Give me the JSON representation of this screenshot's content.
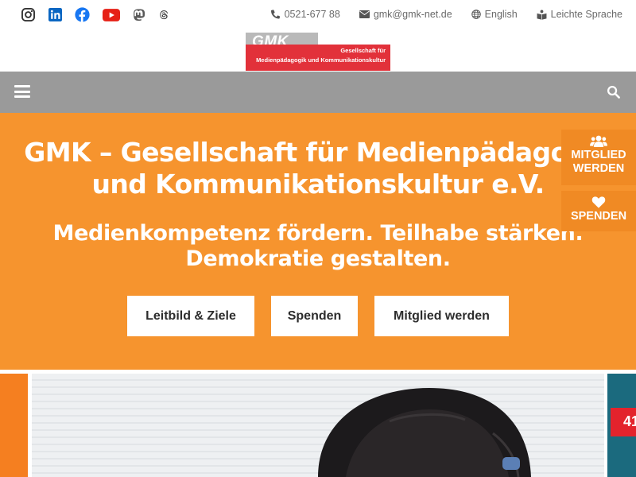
{
  "social": {
    "instagram": "instagram-icon",
    "linkedin": "linkedin-icon",
    "facebook": "facebook-icon",
    "youtube": "youtube-icon",
    "mastodon": "mastodon-icon",
    "threads": "threads-icon"
  },
  "contact": {
    "phone": "0521-677 88",
    "email": "gmk@gmk-net.de",
    "language": "English",
    "easy_language": "Leichte Sprache"
  },
  "logo": {
    "short": "GMK",
    "line1": "Gesellschaft für",
    "line2": "Medienpädagogik und Kommunikationskultur"
  },
  "hero": {
    "title": "GMK – Gesellschaft für Medienpädagogik\nund Kommunikationskultur e.V.",
    "subtitle": "Medienkompetenz fördern. Teilhabe stärken.\nDemokratie gestalten.",
    "buttons": [
      "Leitbild & Ziele",
      "Spenden",
      "Mitglied werden"
    ]
  },
  "sticky": {
    "member": "MITGLIED\nWERDEN",
    "donate": "SPENDEN"
  },
  "badge": "41",
  "colors": {
    "hero_orange": "#f6942e",
    "nav_gray": "#9a9a9a",
    "logo_red": "#e2313a",
    "teal": "#1b6a7e"
  }
}
